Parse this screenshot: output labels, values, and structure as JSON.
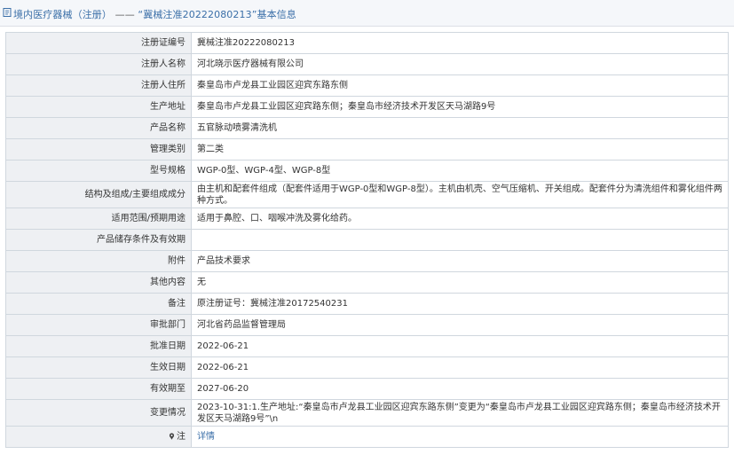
{
  "breadcrumb": {
    "section": "境内医疗器械（注册）",
    "separator": "——",
    "title": "“冀械注准20222080213”基本信息"
  },
  "rows": [
    {
      "label": "注册证编号",
      "value": "冀械注准20222080213"
    },
    {
      "label": "注册人名称",
      "value": "河北晓示医疗器械有限公司"
    },
    {
      "label": "注册人住所",
      "value": "秦皇岛市卢龙县工业园区迎宾东路东侧"
    },
    {
      "label": "生产地址",
      "value": "秦皇岛市卢龙县工业园区迎宾路东侧；秦皇岛市经济技术开发区天马湖路9号"
    },
    {
      "label": "产品名称",
      "value": "五官脉动喷雾清洗机"
    },
    {
      "label": "管理类别",
      "value": "第二类"
    },
    {
      "label": "型号规格",
      "value": "WGP-0型、WGP-4型、WGP-8型"
    },
    {
      "label": "结构及组成/主要组成成分",
      "value": "由主机和配套件组成（配套件适用于WGP-0型和WGP-8型）。主机由机壳、空气压缩机、开关组成。配套件分为清洗组件和雾化组件两种方式。"
    },
    {
      "label": "适用范围/预期用途",
      "value": "适用于鼻腔、口、咽喉冲洗及雾化给药。"
    },
    {
      "label": "产品储存条件及有效期",
      "value": ""
    },
    {
      "label": "附件",
      "value": "产品技术要求"
    },
    {
      "label": "其他内容",
      "value": "无"
    },
    {
      "label": "备注",
      "value": "原注册证号：冀械注准20172540231"
    },
    {
      "label": "审批部门",
      "value": "河北省药品监督管理局"
    },
    {
      "label": "批准日期",
      "value": "2022-06-21"
    },
    {
      "label": "生效日期",
      "value": "2022-06-21"
    },
    {
      "label": "有效期至",
      "value": "2027-06-20"
    },
    {
      "label": "变更情况",
      "value": "2023-10-31:1.生产地址:“秦皇岛市卢龙县工业园区迎宾东路东侧”变更为“秦皇岛市卢龙县工业园区迎宾路东侧；秦皇岛市经济技术开发区天马湖路9号”\\n"
    }
  ],
  "note_row": {
    "label": "注",
    "link": "详情"
  },
  "colors": {
    "link": "#3b6fa8",
    "label_bg": "#eef0f3",
    "border": "#d0d7de"
  }
}
